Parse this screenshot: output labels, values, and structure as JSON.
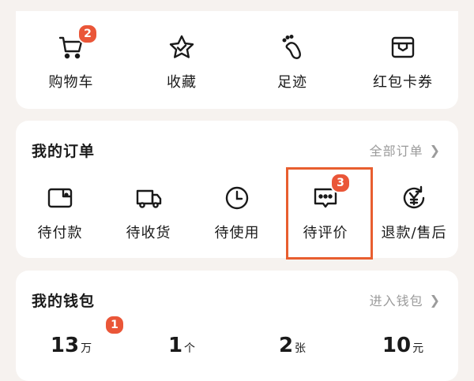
{
  "shortcuts": [
    {
      "label": "购物车",
      "icon": "cart-icon",
      "badge": "2"
    },
    {
      "label": "收藏",
      "icon": "star-icon"
    },
    {
      "label": "足迹",
      "icon": "footprint-icon"
    },
    {
      "label": "红包卡券",
      "icon": "wallet-card-icon"
    }
  ],
  "orders": {
    "title": "我的订单",
    "all_link": "全部订单",
    "items": [
      {
        "label": "待付款",
        "icon": "wallet-icon"
      },
      {
        "label": "待收货",
        "icon": "truck-icon"
      },
      {
        "label": "待使用",
        "icon": "clock-icon"
      },
      {
        "label": "待评价",
        "icon": "comment-icon",
        "badge": "3"
      },
      {
        "label": "退款/售后",
        "icon": "refund-icon"
      }
    ]
  },
  "wallet": {
    "title": "我的钱包",
    "link": "进入钱包",
    "items": [
      {
        "value": "13",
        "unit": "万",
        "badge": "1"
      },
      {
        "value": "1",
        "unit": "个"
      },
      {
        "value": "2",
        "unit": "张"
      },
      {
        "value": "10",
        "unit": "元"
      }
    ]
  },
  "colors": {
    "accent": "#ea5638",
    "highlight": "#e85e2f",
    "muted": "#9b9b9b"
  }
}
